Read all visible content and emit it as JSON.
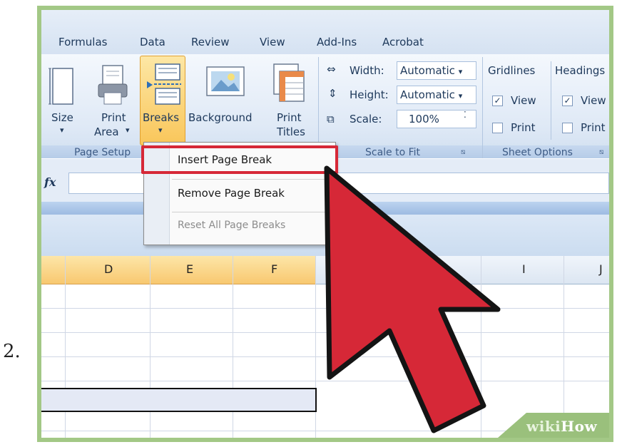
{
  "step": "2.",
  "tabs": [
    "Formulas",
    "Data",
    "Review",
    "View",
    "Add-Ins",
    "Acrobat"
  ],
  "ribbon": {
    "page_setup": {
      "label": "Page Setup",
      "size": "Size",
      "print_area_1": "Print",
      "print_area_2": "Area",
      "breaks": "Breaks",
      "background": "Background",
      "print_titles_1": "Print",
      "print_titles_2": "Titles"
    },
    "scale_to_fit": {
      "label": "Scale to Fit",
      "width_label": "Width:",
      "width_value": "Automatic",
      "height_label": "Height:",
      "height_value": "Automatic",
      "scale_label": "Scale:",
      "scale_value": "100%"
    },
    "sheet_options": {
      "label": "Sheet Options",
      "gridlines": "Gridlines",
      "headings": "Headings",
      "view": "View",
      "print": "Print"
    }
  },
  "formula_bar": {
    "fx": "fx"
  },
  "columns": [
    "D",
    "E",
    "F",
    "I",
    "J"
  ],
  "menu": {
    "insert": "Insert Page Break",
    "remove": "Remove Page Break",
    "reset": "Reset All Page Breaks"
  },
  "watermark": {
    "wiki": "wiki",
    "how": "How"
  },
  "colors": {
    "highlight": "#d62837",
    "arrow": "#d62837",
    "frame": "#a3c886"
  }
}
